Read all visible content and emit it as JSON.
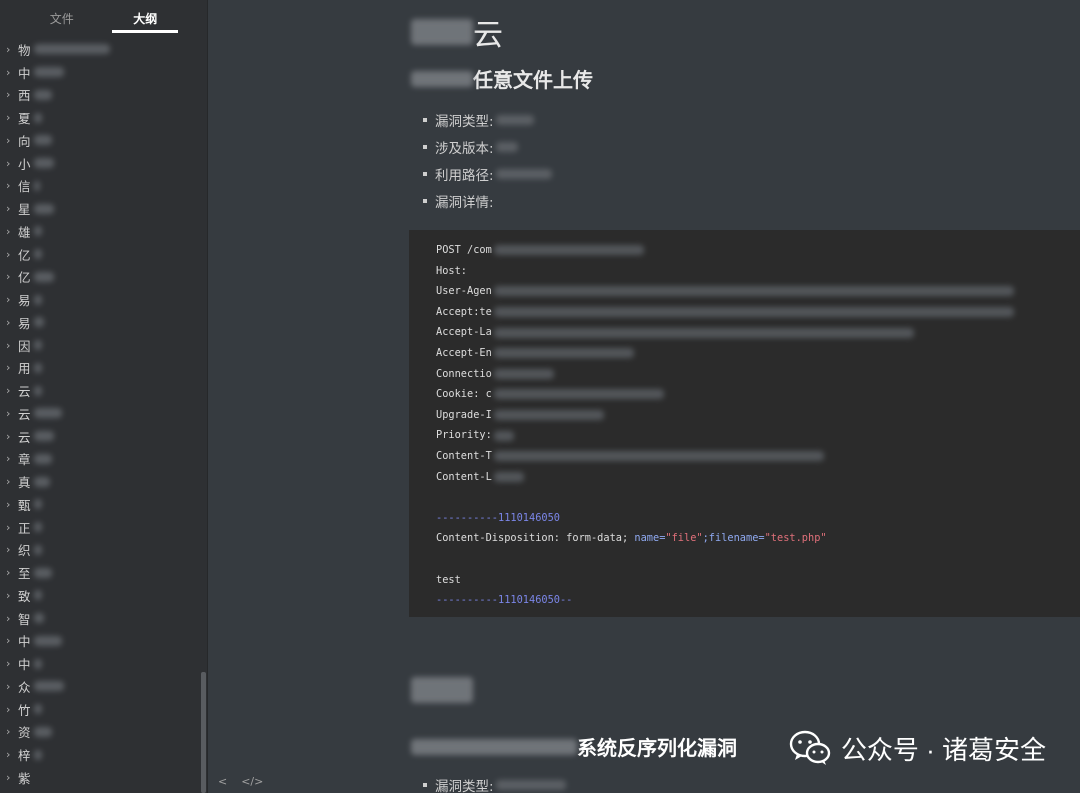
{
  "sidebar": {
    "tabs": [
      {
        "label": "文件",
        "active": false
      },
      {
        "label": "大纲",
        "active": true
      }
    ],
    "outline": [
      {
        "label": "物",
        "blur": 76
      },
      {
        "label": "中",
        "blur": 30
      },
      {
        "label": "西",
        "blur": 18
      },
      {
        "label": "夏",
        "blur": 8
      },
      {
        "label": "向",
        "blur": 18
      },
      {
        "label": "小",
        "blur": 20
      },
      {
        "label": "信",
        "blur": 6
      },
      {
        "label": "星",
        "blur": 20
      },
      {
        "label": "雄",
        "blur": 8
      },
      {
        "label": "亿",
        "blur": 8
      },
      {
        "label": "亿",
        "blur": 20
      },
      {
        "label": "易",
        "blur": 8
      },
      {
        "label": "易",
        "blur": 10
      },
      {
        "label": "因",
        "blur": 8
      },
      {
        "label": "用",
        "blur": 8
      },
      {
        "label": "云",
        "blur": 8
      },
      {
        "label": "云",
        "blur": 28
      },
      {
        "label": "云",
        "blur": 20
      },
      {
        "label": "章",
        "blur": 18
      },
      {
        "label": "真",
        "blur": 16
      },
      {
        "label": "甄",
        "blur": 8
      },
      {
        "label": "正",
        "blur": 8
      },
      {
        "label": "织",
        "blur": 8
      },
      {
        "label": "至",
        "blur": 18
      },
      {
        "label": "致",
        "blur": 8
      },
      {
        "label": "智",
        "blur": 10
      },
      {
        "label": "中",
        "blur": 28
      },
      {
        "label": "中",
        "blur": 8
      },
      {
        "label": "众",
        "blur": 30
      },
      {
        "label": "竹",
        "blur": 8
      },
      {
        "label": "资",
        "blur": 18
      },
      {
        "label": "梓",
        "blur": 8
      },
      {
        "label": "紫",
        "blur": 0
      }
    ],
    "footer": {
      "collapse_icon": "chevron-left-icon",
      "source_icon": "code-icon"
    }
  },
  "main": {
    "h1_suffix": "云",
    "h2_suffix": "任意文件上传",
    "bullets": [
      {
        "label": "漏洞类型:",
        "blur": 38
      },
      {
        "label": "涉及版本:",
        "blur": 22
      },
      {
        "label": "利用路径:",
        "blur": 56
      },
      {
        "label": "漏洞详情:",
        "blur": 0
      }
    ],
    "code": {
      "lines": [
        {
          "text": "POST /com",
          "blur": 150
        },
        {
          "text": "Host:",
          "blur": 0
        },
        {
          "text": "User-Agen",
          "blur": 520
        },
        {
          "text": "Accept:te",
          "blur": 520
        },
        {
          "text": "Accept-La",
          "blur": 420
        },
        {
          "text": "Accept-En",
          "blur": 140
        },
        {
          "text": "Connectio",
          "blur": 60
        },
        {
          "text": "Cookie: c",
          "blur": 170
        },
        {
          "text": "Upgrade-I",
          "blur": 110
        },
        {
          "text": "Priority:",
          "blur": 20
        },
        {
          "text": "Content-T",
          "blur": 330
        },
        {
          "text": "Content-L",
          "blur": 30
        },
        {
          "text": "",
          "blur": 0
        }
      ],
      "boundary": "----------1110146050",
      "disposition_prefix": "Content-Disposition: form-data; ",
      "name_attr": "name=",
      "name_val": "\"file\"",
      "filename_attr": ";filename=",
      "filename_val": "\"test.php\"",
      "body": "test",
      "boundary_end": "----------1110146050--"
    },
    "h2b_suffix": "系统反序列化漏洞",
    "bullet_b": "漏洞类型:"
  },
  "watermark": {
    "text": "公众号 · 诸葛安全",
    "icon": "wechat-icon"
  },
  "colors": {
    "bg": "#363b40",
    "sidebar": "#2e3033",
    "code_bg": "#2b2b2b",
    "boundary": "#7b86e8",
    "string": "#e0707a"
  }
}
